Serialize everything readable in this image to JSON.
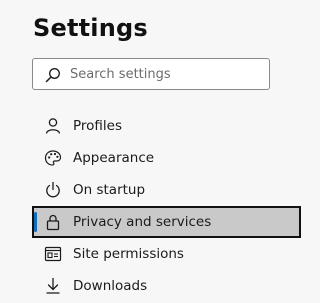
{
  "header": {
    "title": "Settings"
  },
  "search": {
    "placeholder": "Search settings",
    "icon": "search-icon"
  },
  "nav": {
    "items": [
      {
        "label": "Profiles",
        "icon": "person-icon",
        "selected": false
      },
      {
        "label": "Appearance",
        "icon": "palette-icon",
        "selected": false
      },
      {
        "label": "On startup",
        "icon": "power-icon",
        "selected": false
      },
      {
        "label": "Privacy and services",
        "icon": "lock-icon",
        "selected": true
      },
      {
        "label": "Site permissions",
        "icon": "site-permissions-icon",
        "selected": false
      },
      {
        "label": "Downloads",
        "icon": "download-icon",
        "selected": false
      }
    ]
  },
  "colors": {
    "accent": "#0f6cbd",
    "selected_bg": "#c9c9c9"
  }
}
